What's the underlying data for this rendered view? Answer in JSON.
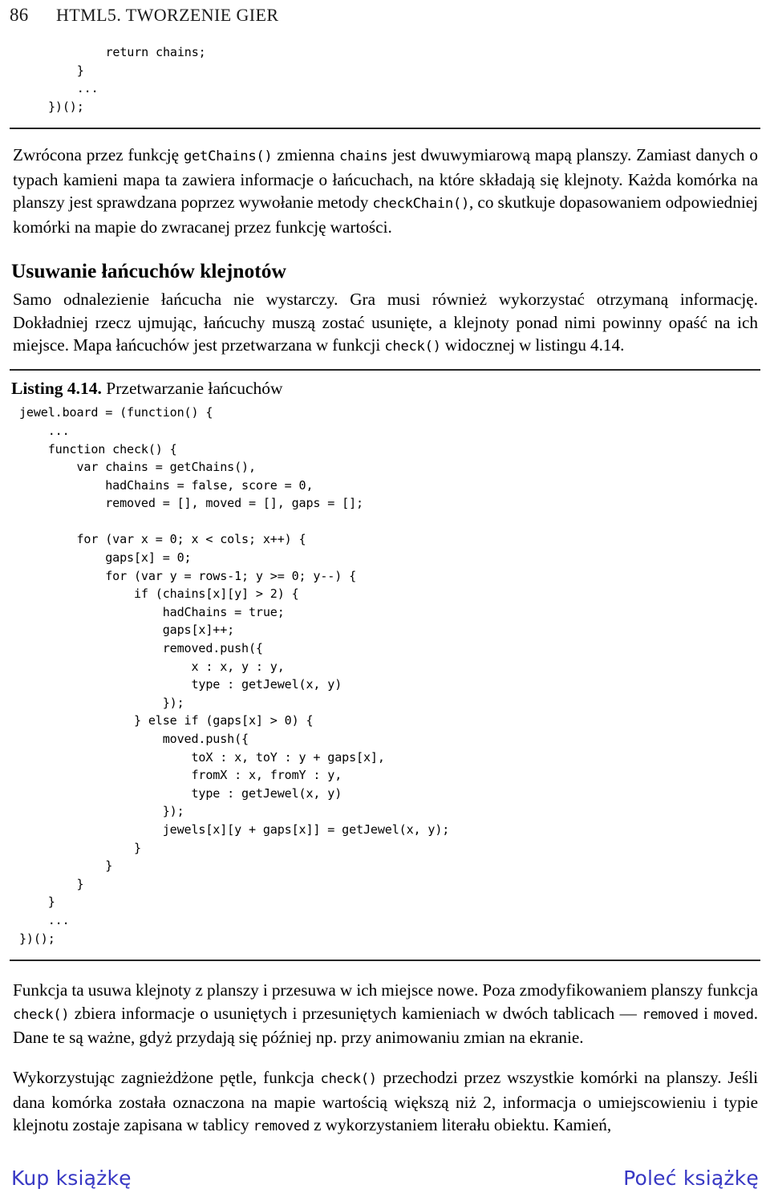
{
  "page": {
    "folio": "86",
    "running_title": "HTML5. TWORZENIE GIER",
    "rule_color": "#262626",
    "link_color": "#3838c4"
  },
  "code_top": "        return chains;\n    }\n    ...\n})();",
  "paragraphs": {
    "p1_part1": "Zwrócona przez funkcję ",
    "p1_code1": "getChains()",
    "p1_part2": " zmienna ",
    "p1_code2": "chains",
    "p1_part3": " jest dwuwymiarową mapą planszy. Zamiast danych o typach kamieni mapa ta zawiera informacje o łańcuchach, na które składają się klejnoty. Każda komórka na planszy jest sprawdzana poprzez wywołanie metody ",
    "p1_code3": "checkChain()",
    "p1_part4": ", co skutkuje dopasowaniem odpowiedniej komórki na mapie do zwracanej przez funkcję wartości.",
    "p2_part1": "Samo odnalezienie łańcucha nie wystarczy. Gra musi również wykorzystać otrzymaną informację. Dokładniej rzecz ujmując, łańcuchy muszą zostać usunięte, a klejnoty ponad nimi powinny opaść na ich miejsce. Mapa łańcuchów jest przetwarzana w funkcji ",
    "p2_code1": "check()",
    "p2_part2": " widocznej w listingu 4.14.",
    "p3_part1": "Funkcja ta usuwa klejnoty z planszy i przesuwa w ich miejsce nowe. Poza zmodyfikowaniem planszy funkcja ",
    "p3_code1": "check()",
    "p3_part2": " zbiera informacje o usuniętych i przesuniętych kamieniach w dwóch tablicach — ",
    "p3_code2": "removed",
    "p3_part3": " i ",
    "p3_code3": "moved",
    "p3_part4": ". Dane te są ważne, gdyż przydają się później np. przy animowaniu zmian na ekranie.",
    "p4_part1": "Wykorzystując zagnieżdżone pętle, funkcja ",
    "p4_code1": "check()",
    "p4_part2": " przechodzi przez wszystkie komórki na planszy. Jeśli dana komórka została oznaczona na mapie wartością większą niż 2, informacja o umiejscowieniu i typie klejnotu zostaje zapisana w tablicy ",
    "p4_code2": "removed",
    "p4_part3": " z wykorzystaniem literału obiektu. Kamień,"
  },
  "section_heading": "Usuwanie łańcuchów klejnotów",
  "listing": {
    "label": "Listing 4.14.",
    "title": " Przetwarzanie łańcuchów",
    "code": "jewel.board = (function() {\n    ...\n    function check() {\n        var chains = getChains(),\n            hadChains = false, score = 0,\n            removed = [], moved = [], gaps = [];\n\n        for (var x = 0; x < cols; x++) {\n            gaps[x] = 0;\n            for (var y = rows-1; y >= 0; y--) {\n                if (chains[x][y] > 2) {\n                    hadChains = true;\n                    gaps[x]++;\n                    removed.push({\n                        x : x, y : y,\n                        type : getJewel(x, y)\n                    });\n                } else if (gaps[x] > 0) {\n                    moved.push({\n                        toX : x, toY : y + gaps[x],\n                        fromX : x, fromY : y,\n                        type : getJewel(x, y)\n                    });\n                    jewels[x][y + gaps[x]] = getJewel(x, y);\n                }\n            }\n        }\n    }\n    ...\n})();"
  },
  "footer": {
    "buy_label": "Kup książkę",
    "recommend_label": "Poleć książkę"
  }
}
